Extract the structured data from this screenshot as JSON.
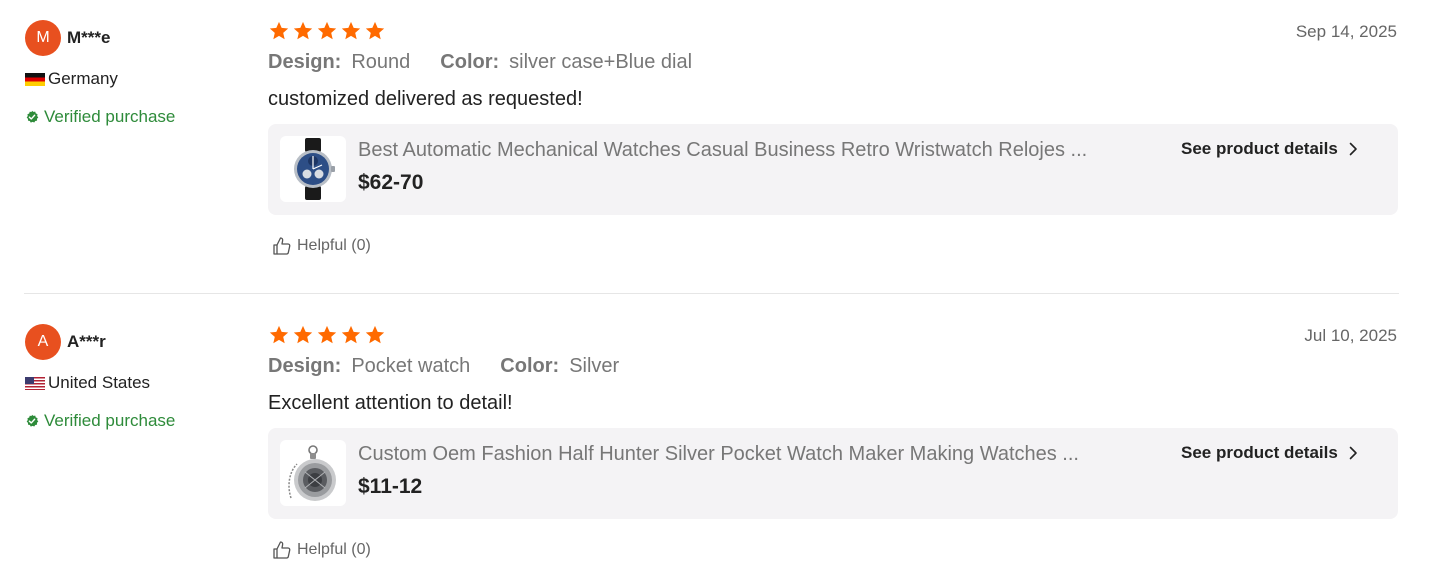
{
  "colors": {
    "avatar_bg": "#e8501f",
    "star": "#ff6a00",
    "verified": "#2e8b3a",
    "card_bg": "#f4f3f5"
  },
  "reviews": [
    {
      "avatar_letter": "M",
      "username": "M***e",
      "country": "Germany",
      "flag_icon": "germany-flag-icon",
      "verified_label": "Verified purchase",
      "rating": 5,
      "date": "Sep 14, 2025",
      "sku": [
        {
          "key": "Design:",
          "value": "Round"
        },
        {
          "key": "Color:",
          "value": "silver case+Blue dial"
        }
      ],
      "comment": "customized delivered as requested!",
      "product": {
        "title": "Best Automatic Mechanical Watches Casual Business Retro Wristwatch Relojes ...",
        "price": "$62-70",
        "details_label": "See product details",
        "thumbnail_icon": "wristwatch-icon"
      },
      "helpful_label": "Helpful (0)"
    },
    {
      "avatar_letter": "A",
      "username": "A***r",
      "country": "United States",
      "flag_icon": "us-flag-icon",
      "verified_label": "Verified purchase",
      "rating": 5,
      "date": "Jul 10, 2025",
      "sku": [
        {
          "key": "Design:",
          "value": "Pocket watch"
        },
        {
          "key": "Color:",
          "value": "Silver"
        }
      ],
      "comment": "Excellent attention to detail!",
      "product": {
        "title": "Custom Oem Fashion Half Hunter Silver Pocket Watch Maker Making Watches ...",
        "price": "$11-12",
        "details_label": "See product details",
        "thumbnail_icon": "pocket-watch-icon"
      },
      "helpful_label": "Helpful (0)"
    }
  ]
}
